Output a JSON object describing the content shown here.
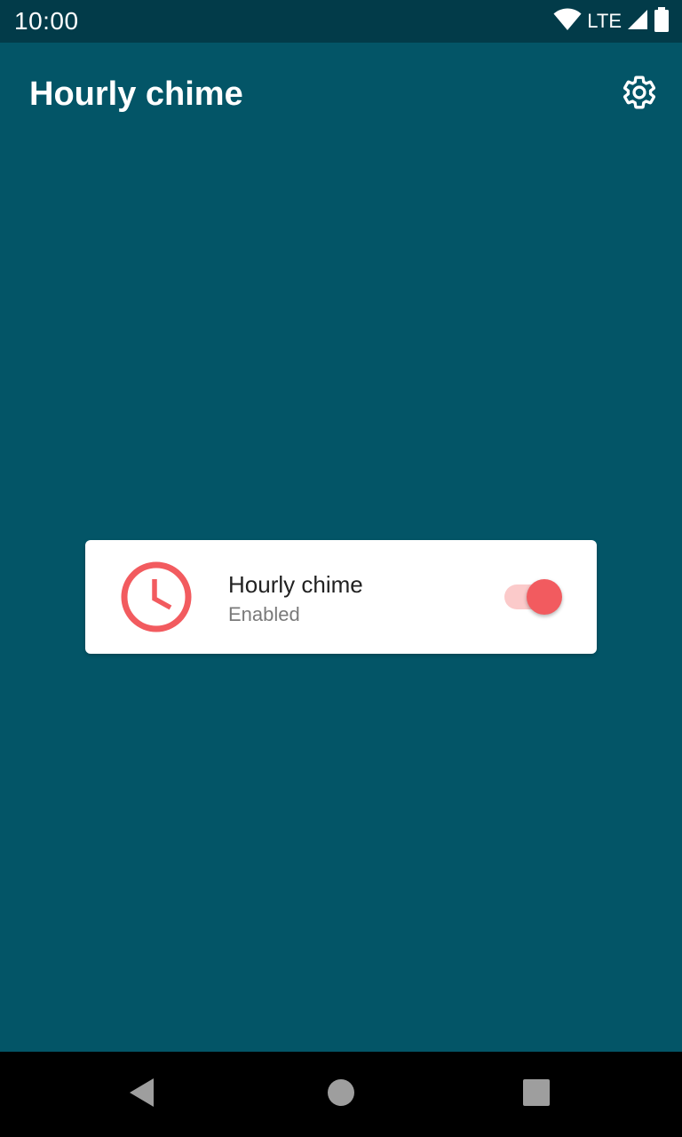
{
  "status_bar": {
    "time": "10:00",
    "network": "LTE",
    "icons": [
      "wifi-icon",
      "cell-signal-icon",
      "battery-icon"
    ]
  },
  "app_bar": {
    "title": "Hourly chime",
    "settings_icon": "gear-icon"
  },
  "chime_card": {
    "icon": "clock-icon",
    "title": "Hourly chime",
    "status": "Enabled",
    "switch_on": true
  },
  "nav_bar": {
    "icons": [
      "back-icon",
      "home-icon",
      "recents-icon"
    ]
  },
  "colors": {
    "background": "#035567",
    "status_bar": "#023b49",
    "accent": "#f25b5f",
    "track_on": "#fbcaca",
    "card": "#ffffff"
  }
}
